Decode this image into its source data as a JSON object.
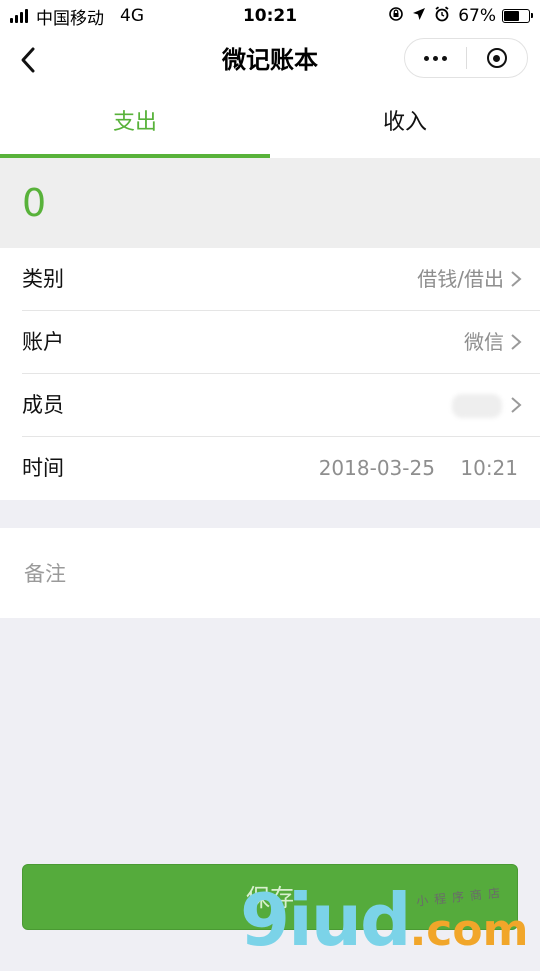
{
  "status_bar": {
    "carrier": "中国移动",
    "network": "4G",
    "time": "10:21",
    "battery": "67%",
    "battery_level": 0.67,
    "icons": [
      "rotation-lock-icon",
      "location-icon",
      "alarm-icon",
      "battery-icon"
    ]
  },
  "nav": {
    "back_icon": "chevron-left-icon",
    "title": "微记账本",
    "capsule": {
      "more_icon": "more-dots-icon",
      "close_icon": "target-circle-icon"
    }
  },
  "tabs": [
    {
      "label": "支出",
      "active": true
    },
    {
      "label": "收入",
      "active": false
    }
  ],
  "amount": "0",
  "form": {
    "category": {
      "label": "类别",
      "value": "借钱/借出"
    },
    "account": {
      "label": "账户",
      "value": "微信"
    },
    "member": {
      "label": "成员",
      "value": ""
    },
    "time": {
      "label": "时间",
      "value": "2018-03-25    10:21"
    }
  },
  "note": {
    "placeholder": "备注",
    "value": ""
  },
  "save_label": "保存",
  "watermark": {
    "big": "9iud",
    "suffix": ".com",
    "small": "小程序商店"
  },
  "colors": {
    "accent": "#58b23a",
    "button": "#55ab3c",
    "background": "#efeff4",
    "muted_text": "#8e8e8e"
  }
}
